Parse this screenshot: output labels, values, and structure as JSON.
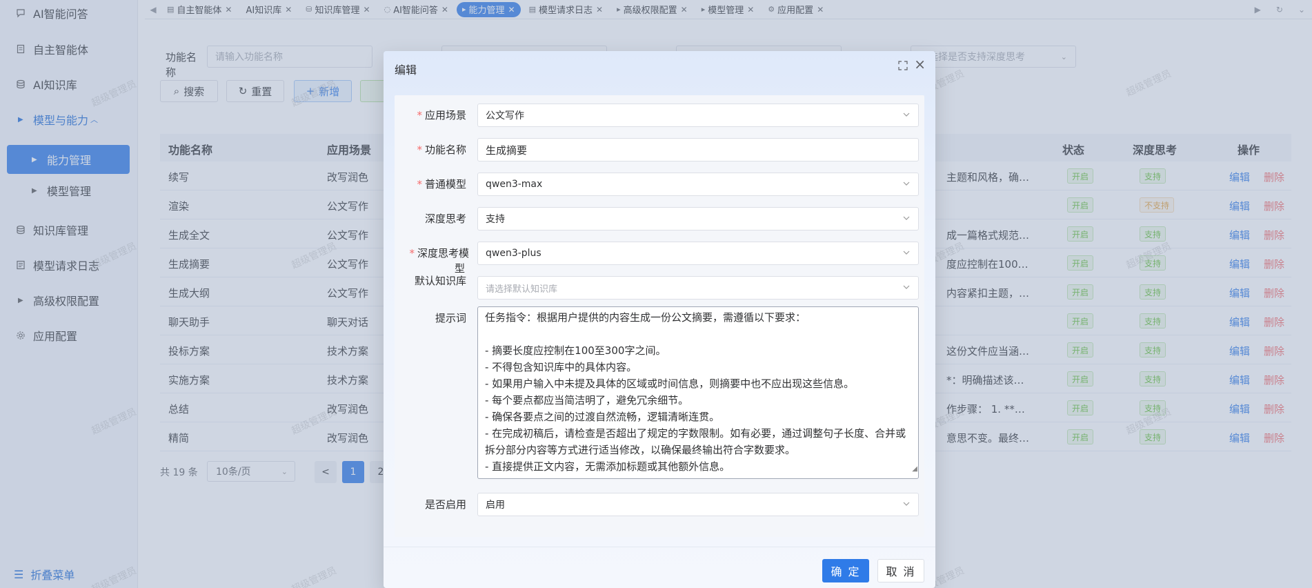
{
  "sidebar": {
    "items": [
      {
        "label": "AI智能问答",
        "icon": "chat-icon"
      },
      {
        "label": "自主智能体",
        "icon": "document-icon"
      },
      {
        "label": "AI知识库",
        "icon": "database-icon"
      },
      {
        "label": "模型与能力",
        "icon": "caret-right-icon"
      },
      {
        "label": "能力管理",
        "icon": "caret-right-icon"
      },
      {
        "label": "模型管理",
        "icon": "caret-right-icon"
      },
      {
        "label": "知识库管理",
        "icon": "database-icon"
      },
      {
        "label": "模型请求日志",
        "icon": "log-icon"
      },
      {
        "label": "高级权限配置",
        "icon": "caret-right-icon"
      },
      {
        "label": "应用配置",
        "icon": "gear-icon"
      }
    ],
    "fold_label": "折叠菜单"
  },
  "tabs": [
    {
      "label": "自主智能体",
      "icon": "document-icon"
    },
    {
      "label": "AI知识库",
      "icon": ""
    },
    {
      "label": "知识库管理",
      "icon": "database-icon"
    },
    {
      "label": "AI智能问答",
      "icon": "chat-icon"
    },
    {
      "label": "能力管理",
      "icon": "caret-right-icon",
      "active": true
    },
    {
      "label": "模型请求日志",
      "icon": "log-icon"
    },
    {
      "label": "高级权限配置",
      "icon": "caret-right-icon"
    },
    {
      "label": "模型管理",
      "icon": "caret-right-icon"
    },
    {
      "label": "应用配置",
      "icon": "gear-icon"
    }
  ],
  "filter": {
    "name_label": "功能名称",
    "name_placeholder": "请输入功能名称",
    "deep_placeholder": "请选择是否支持深度思考",
    "search_btn": "搜索",
    "reset_btn": "重置",
    "add_btn": "新增"
  },
  "table": {
    "headers": {
      "name": "功能名称",
      "scene": "应用场景",
      "status": "状态",
      "deep": "深度思考",
      "ops": "操作"
    },
    "rows": [
      {
        "name": "续写",
        "scene": "改写润色",
        "prompt_tail": "主题和风格，确…",
        "status": "开启",
        "deep": "支持"
      },
      {
        "name": "渲染",
        "scene": "公文写作",
        "prompt_tail": "",
        "status": "开启",
        "deep": "不支持"
      },
      {
        "name": "生成全文",
        "scene": "公文写作",
        "prompt_tail": "成一篇格式规范…",
        "status": "开启",
        "deep": "支持"
      },
      {
        "name": "生成摘要",
        "scene": "公文写作",
        "prompt_tail": "度应控制在100…",
        "status": "开启",
        "deep": "支持"
      },
      {
        "name": "生成大纲",
        "scene": "公文写作",
        "prompt_tail": "内容紧扣主题，…",
        "status": "开启",
        "deep": "支持"
      },
      {
        "name": "聊天助手",
        "scene": "聊天对话",
        "prompt_tail": "",
        "status": "开启",
        "deep": "支持"
      },
      {
        "name": "投标方案",
        "scene": "技术方案",
        "prompt_tail": "这份文件应当涵…",
        "status": "开启",
        "deep": "支持"
      },
      {
        "name": "实施方案",
        "scene": "技术方案",
        "prompt_tail": "*：明确描述该…",
        "status": "开启",
        "deep": "支持"
      },
      {
        "name": "总结",
        "scene": "改写润色",
        "prompt_tail": "作步骤：  1. **…",
        "status": "开启",
        "deep": "支持"
      },
      {
        "name": "精简",
        "scene": "改写润色",
        "prompt_tail": "意思不变。最终…",
        "status": "开启",
        "deep": "支持"
      }
    ],
    "edit_label": "编辑",
    "delete_label": "删除"
  },
  "pager": {
    "total": "共 19 条",
    "page_size": "10条/页",
    "prev": "<",
    "pages": [
      "1",
      "2"
    ]
  },
  "watermark": "超级管理员",
  "dialog": {
    "title": "编辑",
    "fields": {
      "scene": {
        "label": "应用场景",
        "value": "公文写作",
        "required": true
      },
      "name": {
        "label": "功能名称",
        "value": "生成摘要",
        "required": true
      },
      "model": {
        "label": "普通模型",
        "value": "qwen3-max",
        "required": true
      },
      "deep": {
        "label": "深度思考",
        "value": "支持",
        "required": false
      },
      "deep_model": {
        "label": "深度思考模",
        "label2": "型",
        "value": "qwen3-plus",
        "required": true
      },
      "kb": {
        "label": "默认知识库",
        "placeholder": "请选择默认知识库",
        "required": false
      },
      "prompt": {
        "label": "提示词",
        "required": false
      },
      "enabled": {
        "label": "是否启用",
        "value": "启用",
        "required": false
      }
    },
    "prompt_lines": [
      "任务指令：根据用户提供的内容生成一份公文摘要，需遵循以下要求：",
      "",
      "- 摘要长度应控制在100至300字之间。",
      "- 不得包含知识库中的具体内容。",
      "- 如果用户输入中未提及具体的区域或时间信息，则摘要中也不应出现这些信息。",
      "- 每个要点都应当简洁明了，避免冗余细节。",
      "- 确保各要点之间的过渡自然流畅，逻辑清晰连贯。",
      "- 在完成初稿后，请检查是否超出了规定的字数限制。如有必要，通过调整句子长度、合并或拆分部分内容等方式进行适当修改，以确保最终输出符合字数要求。",
      "- 直接提供正文内容，无需添加标题或其他额外信息。"
    ],
    "ok_label": "确 定",
    "cancel_label": "取 消"
  }
}
